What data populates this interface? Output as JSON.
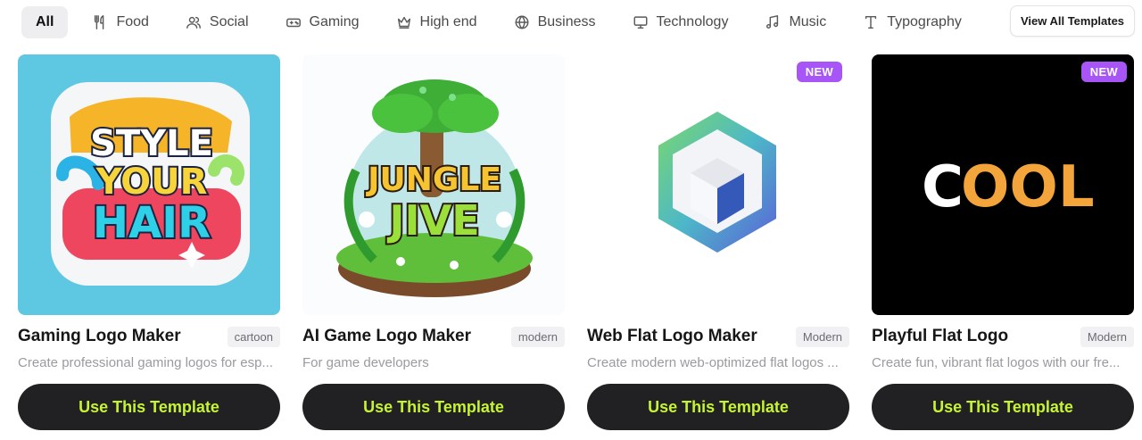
{
  "filters": [
    {
      "label": "All",
      "icon": "",
      "active": true
    },
    {
      "label": "Food",
      "icon": "utensils-icon"
    },
    {
      "label": "Social",
      "icon": "users-icon"
    },
    {
      "label": "Gaming",
      "icon": "gamepad-icon"
    },
    {
      "label": "High end",
      "icon": "crown-icon"
    },
    {
      "label": "Business",
      "icon": "globe-icon"
    },
    {
      "label": "Technology",
      "icon": "monitor-icon"
    },
    {
      "label": "Music",
      "icon": "music-icon"
    },
    {
      "label": "Typography",
      "icon": "type-icon"
    }
  ],
  "view_all_label": "View All Templates",
  "cards": [
    {
      "title": "Gaming Logo Maker",
      "tag": "cartoon",
      "description": "Create professional gaming logos for esp...",
      "button": "Use This Template",
      "art_text": [
        "STYLE",
        "YOUR",
        "HAIR"
      ]
    },
    {
      "title": "AI Game Logo Maker",
      "tag": "modern",
      "description": "For game developers",
      "button": "Use This Template",
      "art_text": [
        "JUNGLE",
        "JIVE"
      ]
    },
    {
      "title": "Web Flat Logo Maker",
      "tag": "Modern",
      "description": "Create modern web-optimized flat logos ...",
      "button": "Use This Template",
      "badge": "NEW"
    },
    {
      "title": "Playful Flat Logo",
      "tag": "Modern",
      "description": "Create fun, vibrant flat logos with our fre...",
      "button": "Use This Template",
      "badge": "NEW",
      "art_text": [
        "C",
        "OOL"
      ]
    }
  ],
  "colors": {
    "accent_text": "#c6f432",
    "button_bg": "#212124",
    "badge_bg": "#a855f7"
  }
}
